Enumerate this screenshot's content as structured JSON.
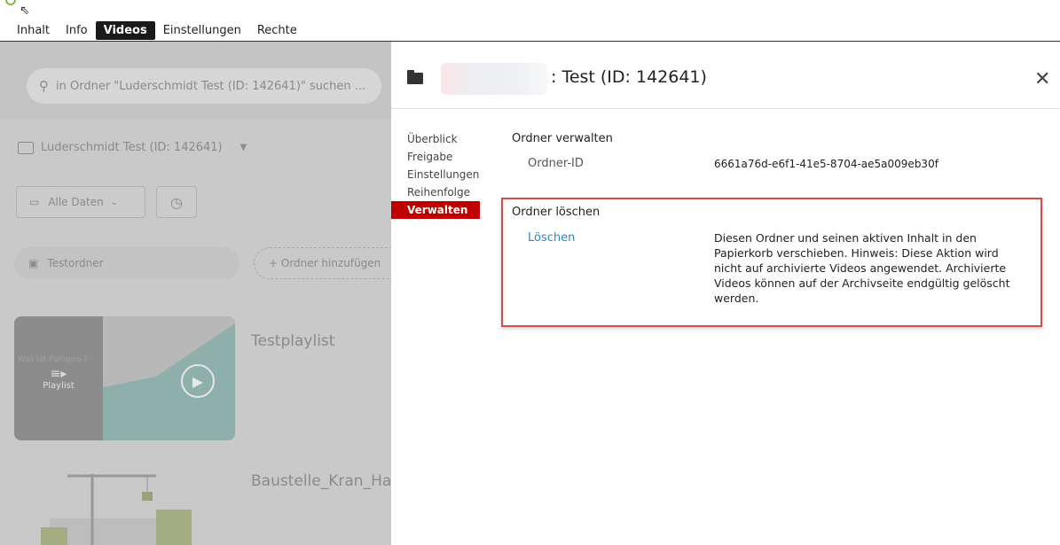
{
  "tabs": {
    "items": [
      "Inhalt",
      "Info",
      "Videos",
      "Einstellungen",
      "Rechte"
    ],
    "active_index": 2
  },
  "left": {
    "search_placeholder": "in Ordner \"Luderschmidt Test (ID: 142641)\" suchen ...",
    "folder_name": "Luderschmidt Test (ID: 142641)",
    "date_filter": "Alle Daten",
    "subfolder": "Testordner",
    "add_folder": "+ Ordner hinzufügen",
    "items": [
      {
        "title": "Testplaylist",
        "badge": "Playlist",
        "overlay_text": "Was ist Panopto ?"
      },
      {
        "title": "Baustelle_Kran_Hae"
      }
    ]
  },
  "modal": {
    "title": ": Test (ID: 142641)",
    "nav": [
      "Überblick",
      "Freigabe",
      "Einstellungen",
      "Reihenfolge",
      "Verwalten"
    ],
    "active_nav_index": 4,
    "manage": {
      "section_title": "Ordner verwalten",
      "id_label": "Ordner-ID",
      "id_value": "6661a76d-e6f1-41e5-8704-ae5a009eb30f"
    },
    "delete": {
      "section_title": "Ordner löschen",
      "link_label": "Löschen",
      "description": "Diesen Ordner und seinen aktiven Inhalt in den Papierkorb verschieben. Hinweis: Diese Aktion wird nicht auf archivierte Videos angewendet. Archivierte Videos können auf der Archivseite endgültig gelöscht werden."
    }
  },
  "colors": {
    "accent_red": "#c00000",
    "link_blue": "#2a8ac0",
    "highlight_border": "#d94b4b"
  }
}
